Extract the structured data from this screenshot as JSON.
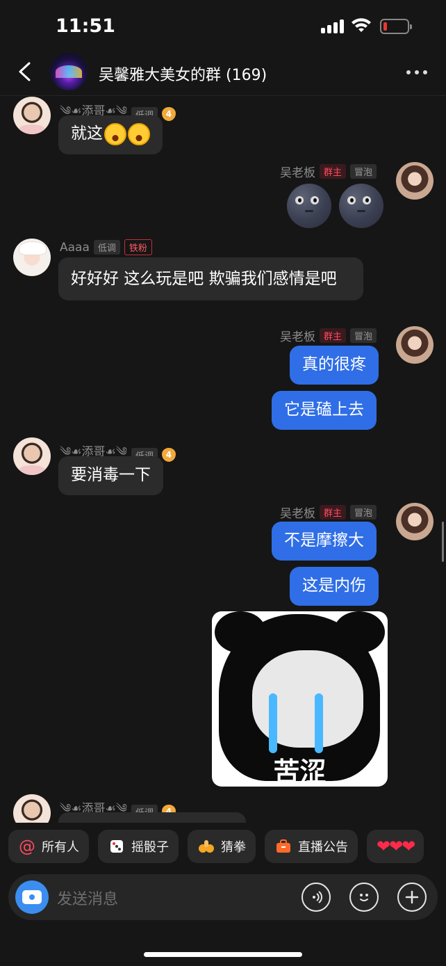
{
  "status": {
    "time": "11:51",
    "battery_color": "#e53935"
  },
  "header": {
    "title": "吴馨雅大美女的群 (169)",
    "back_icon": "chevron-left-icon",
    "more_icon": "more-dots-icon"
  },
  "users": {
    "tian": {
      "name": "༄☙添哥☙༄"
    },
    "boss": {
      "name": "吴老板"
    },
    "aaaa": {
      "name": "Aaaa"
    }
  },
  "tags": {
    "low": "低调",
    "owner": "群主",
    "bubble": "冒泡",
    "fan": "铁粉",
    "level": "4"
  },
  "messages": {
    "m1": "就这",
    "m3": "好好好 这么玩是吧 欺骗我们感情是吧",
    "m4a": "真的很疼",
    "m4b": "它是磕上去",
    "m5": "要消毒一下",
    "m6a": "不是摩擦大",
    "m6b": "这是内伤",
    "sticker_text": "苦涩"
  },
  "quickbar": {
    "all": "所有人",
    "dice": "摇骰子",
    "rps": "猜拳",
    "notice": "直播公告",
    "hearts": "❤❤❤"
  },
  "input": {
    "placeholder": "发送消息"
  },
  "colors": {
    "accent": "#2f6ee6",
    "owner_tag": "#ff4a5e",
    "background": "#161616"
  }
}
